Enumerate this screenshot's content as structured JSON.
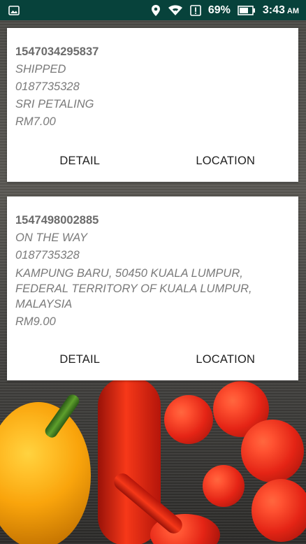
{
  "status_bar": {
    "left_icon": "image-icon",
    "icons": [
      "location-icon",
      "wifi-icon",
      "alert-icon",
      "battery-icon"
    ],
    "battery_percent": "69%",
    "time": "3:43",
    "am_pm": "AM"
  },
  "orders": [
    {
      "id": "1547034295837",
      "status": "SHIPPED",
      "phone": "0187735328",
      "address": "SRI PETALING",
      "price": "RM7.00",
      "detail_label": "DETAIL",
      "location_label": "LOCATION"
    },
    {
      "id": "1547498002885",
      "status": "ON THE WAY",
      "phone": "0187735328",
      "address": "KAMPUNG BARU, 50450 KUALA LUMPUR, FEDERAL TERRITORY OF KUALA LUMPUR, MALAYSIA",
      "price": "RM9.00",
      "detail_label": "DETAIL",
      "location_label": "LOCATION"
    }
  ],
  "colors": {
    "status_bar": "#07423b",
    "card": "#ffffff",
    "text_primary": "#6b6b6b",
    "button_text": "#1f1f1f"
  }
}
